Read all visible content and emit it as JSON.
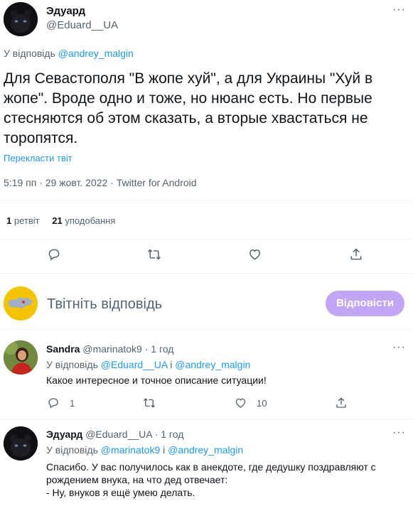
{
  "main_tweet": {
    "author_name": "Эдуард",
    "author_handle": "@Eduard__UA",
    "reply_prefix": "У відповідь",
    "reply_to": "@andrey_malgin",
    "text": "Для Севастополя \"В жопе хуй\", а для Украины \"Хуй в жопе\". Вроде одно и тоже, но нюанс есть. Но первые стесняются об этом сказать, а вторые хвастаться не торопятся.",
    "translate": "Перекласти твіт",
    "meta": "5:19 пп · 29 жовт. 2022 · Twitter for Android",
    "retweets_count": "1",
    "retweets_label": "ретвіт",
    "likes_count": "21",
    "likes_label": "уподобання",
    "more_icon": "more-horizontal-icon"
  },
  "action_icons": [
    "reply-icon",
    "retweet-icon",
    "like-icon",
    "share-icon"
  ],
  "compose": {
    "placeholder": "Твітніть відповідь",
    "button_label": "Відповісти",
    "button_color": "#c3a5f5"
  },
  "replies": [
    {
      "author_name": "Sandra",
      "author_handle": "@marinatok9",
      "time": "· 1 год",
      "reply_prefix": "У відповідь",
      "reply_to_1": "@Eduard__UA",
      "conj": "і",
      "reply_to_2": "@andrey_malgin",
      "text": "Какое интересное и точное описание ситуации!",
      "reply_count": "1",
      "like_count": "10"
    },
    {
      "author_name": "Эдуард",
      "author_handle": "@Eduard__UA",
      "time": "· 1 год",
      "reply_prefix": "У відповідь",
      "reply_to_1": "@marinatok9",
      "conj": "і",
      "reply_to_2": "@andrey_malgin",
      "text_line1": "Спасибо. У вас получилось как в анекдоте, где дедушку поздравляют с рождением внука, на что дед отвечает:",
      "text_line2": "- Ну, внуков я ещё умею делать."
    }
  ],
  "colors": {
    "link": "#1d9bf0",
    "muted": "#536471",
    "divider": "#eff3f4"
  }
}
